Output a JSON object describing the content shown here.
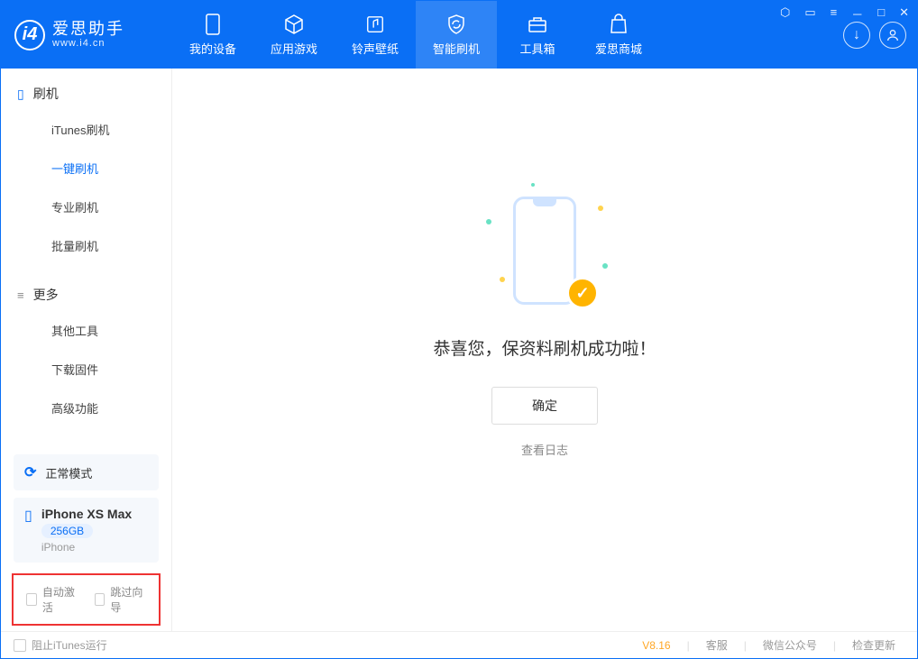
{
  "app": {
    "title": "爱思助手",
    "url": "www.i4.cn"
  },
  "tabs": {
    "device": "我的设备",
    "apps": "应用游戏",
    "ring": "铃声壁纸",
    "flash": "智能刷机",
    "tools": "工具箱",
    "store": "爱思商城"
  },
  "sidebar": {
    "flash_head": "刷机",
    "flash_items": {
      "itunes": "iTunes刷机",
      "oneclick": "一键刷机",
      "pro": "专业刷机",
      "batch": "批量刷机"
    },
    "more_head": "更多",
    "more_items": {
      "other": "其他工具",
      "firmware": "下载固件",
      "advanced": "高级功能"
    },
    "mode_label": "正常模式",
    "device": {
      "name": "iPhone XS Max",
      "capacity": "256GB",
      "type": "iPhone"
    },
    "options": {
      "auto_activate": "自动激活",
      "skip_guide": "跳过向导"
    }
  },
  "content": {
    "success_msg": "恭喜您，保资料刷机成功啦！",
    "confirm": "确定",
    "view_log": "查看日志"
  },
  "footer": {
    "block_itunes": "阻止iTunes运行",
    "version": "V8.16",
    "service": "客服",
    "wechat": "微信公众号",
    "update": "检查更新"
  }
}
